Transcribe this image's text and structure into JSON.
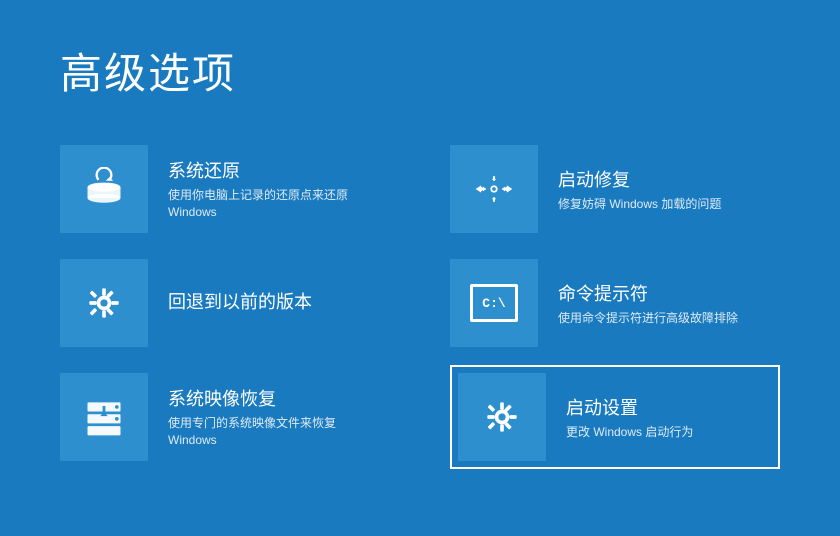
{
  "page": {
    "title": "高级选项",
    "background_color": "#1a7abf"
  },
  "options": [
    {
      "id": "system-restore",
      "title": "系统还原",
      "desc_line1": "使用你电脑上记录的还原点来还原",
      "desc_line2": "Windows",
      "icon": "restore",
      "selected": false
    },
    {
      "id": "startup-repair",
      "title": "启动修复",
      "desc_line1": "修复妨碍 Windows 加载的问题",
      "desc_line2": "",
      "icon": "startup-repair",
      "selected": false
    },
    {
      "id": "go-back",
      "title": "回退到以前的版本",
      "desc_line1": "",
      "desc_line2": "",
      "icon": "gear",
      "selected": false
    },
    {
      "id": "command-prompt",
      "title": "命令提示符",
      "desc_line1": "使用命令提示符进行高级故障排除",
      "desc_line2": "",
      "icon": "cmd",
      "selected": false
    },
    {
      "id": "system-image",
      "title": "系统映像恢复",
      "desc_line1": "使用专门的系统映像文件来恢复",
      "desc_line2": "Windows",
      "icon": "image-restore",
      "selected": false
    },
    {
      "id": "startup-settings",
      "title": "启动设置",
      "desc_line1": "更改 Windows 启动行为",
      "desc_line2": "",
      "icon": "gear2",
      "selected": true
    }
  ]
}
